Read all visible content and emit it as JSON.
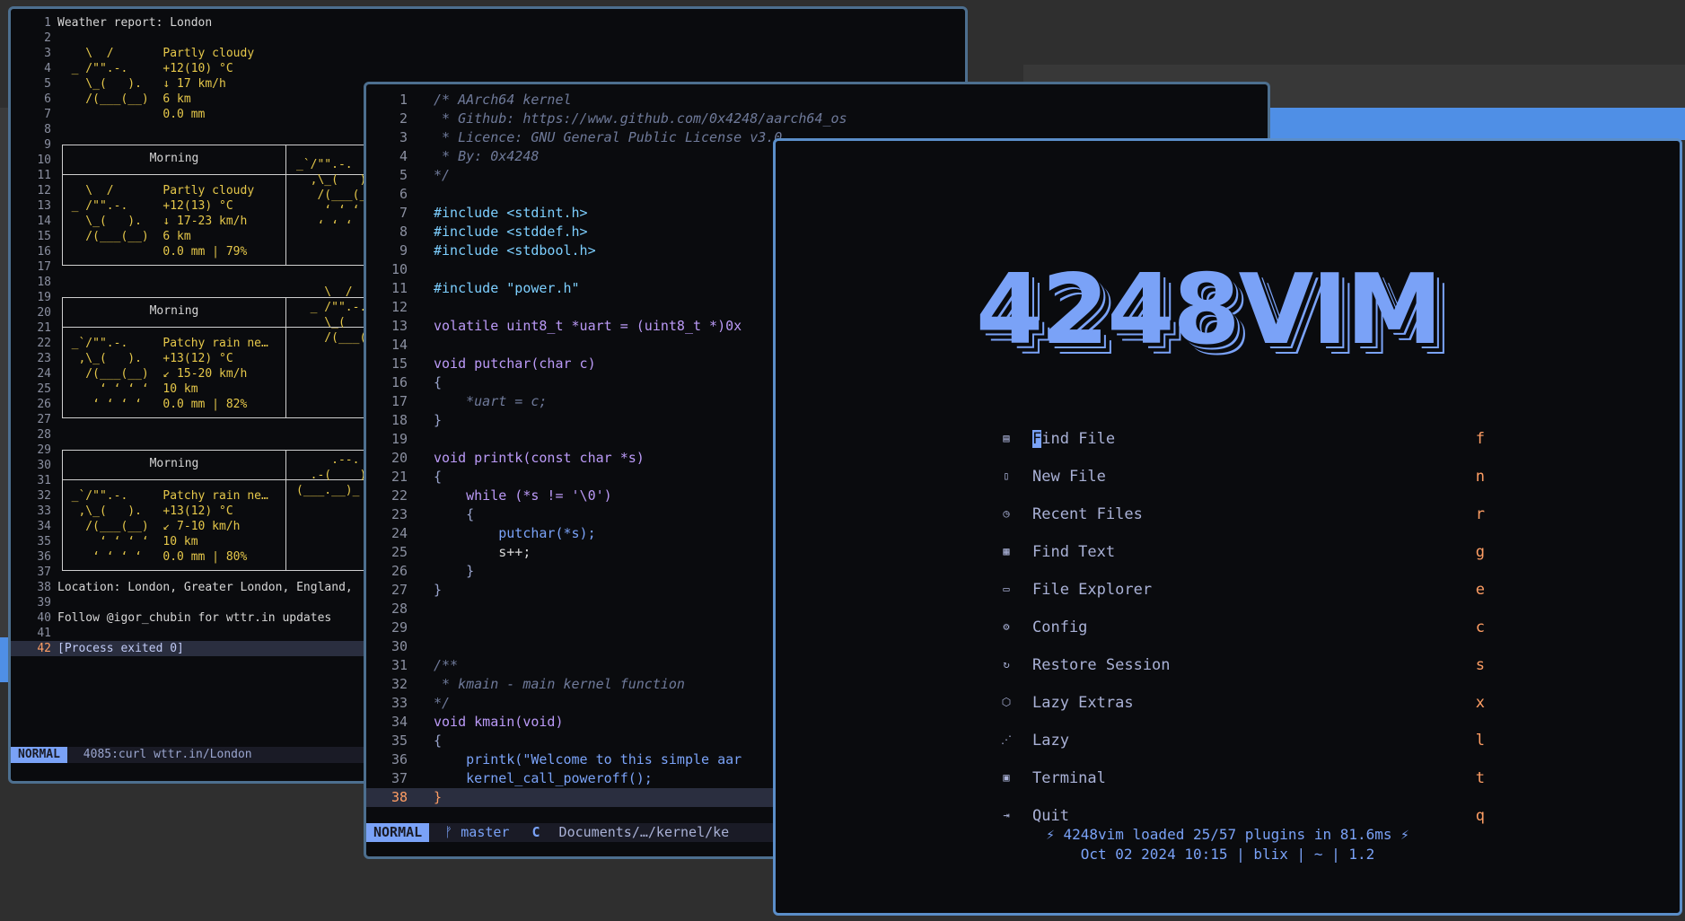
{
  "colors": {
    "accent": "#7aa2f7",
    "background": "#0a0b0e",
    "orange": "#ff9e64"
  },
  "weather": {
    "lines": [
      {
        "n": "1",
        "t": "Weather report: London"
      },
      {
        "n": "2",
        "t": ""
      },
      {
        "n": "3",
        "t": "    \\  /       Partly cloudy"
      },
      {
        "n": "4",
        "t": "  _ /\"\".-.     +12(10) °C"
      },
      {
        "n": "5",
        "t": "    \\_(   ).   ↓ 17 km/h"
      },
      {
        "n": "6",
        "t": "    /(___(__)  6 km"
      },
      {
        "n": "7",
        "t": "               0.0 mm"
      },
      {
        "n": "8",
        "t": ""
      },
      {
        "n": "9",
        "t": ""
      },
      {
        "n": "10",
        "t": ""
      },
      {
        "n": "11",
        "t": ""
      },
      {
        "n": "12",
        "t": "    \\  /       Partly cloudy"
      },
      {
        "n": "13",
        "t": "  _ /\"\".-.     +12(13) °C"
      },
      {
        "n": "14",
        "t": "    \\_(   ).   ↓ 17-23 km/h"
      },
      {
        "n": "15",
        "t": "    /(___(__)  6 km"
      },
      {
        "n": "16",
        "t": "               0.0 mm | 79%"
      },
      {
        "n": "17",
        "t": ""
      },
      {
        "n": "18",
        "t": ""
      },
      {
        "n": "19",
        "t": ""
      },
      {
        "n": "20",
        "t": ""
      },
      {
        "n": "21",
        "t": ""
      },
      {
        "n": "22",
        "t": "  _`/\"\".-.     Patchy rain ne…"
      },
      {
        "n": "23",
        "t": "   ,\\_(   ).   +13(12) °C"
      },
      {
        "n": "24",
        "t": "    /(___(__)  ↙ 15-20 km/h"
      },
      {
        "n": "25",
        "t": "      ‘ ‘ ‘ ‘  10 km"
      },
      {
        "n": "26",
        "t": "     ‘ ‘ ‘ ‘   0.0 mm | 82%"
      },
      {
        "n": "27",
        "t": ""
      },
      {
        "n": "28",
        "t": ""
      },
      {
        "n": "29",
        "t": ""
      },
      {
        "n": "30",
        "t": ""
      },
      {
        "n": "31",
        "t": ""
      },
      {
        "n": "32",
        "t": "  _`/\"\".-.     Patchy rain ne…"
      },
      {
        "n": "33",
        "t": "   ,\\_(   ).   +13(12) °C"
      },
      {
        "n": "34",
        "t": "    /(___(__)  ↙ 7-10 km/h"
      },
      {
        "n": "35",
        "t": "      ‘ ‘ ‘ ‘  10 km"
      },
      {
        "n": "36",
        "t": "     ‘ ‘ ‘ ‘   0.0 mm | 80%"
      },
      {
        "n": "37",
        "t": ""
      },
      {
        "n": "38",
        "t": "Location: London, Greater London, England,"
      },
      {
        "n": "39",
        "t": ""
      },
      {
        "n": "40",
        "t": "Follow @igor_chubin for wttr.in updates"
      },
      {
        "n": "41",
        "t": ""
      },
      {
        "n": "42",
        "t": "[Process exited 0]"
      }
    ],
    "box_titles": [
      "Morning",
      "Morning",
      "Morning"
    ],
    "box2_right": [
      "_`/\"\".-.",
      "  ,\\_(   )",
      "   /(___(_",
      "    ‘ ‘ ‘",
      "   ‘ ‘ ‘"
    ],
    "box3_right": [
      "    \\  /",
      "  _ /\"\".-.",
      "    \\_(   )",
      "    /(___("
    ],
    "box4_right": [
      "",
      "     .--.",
      "  .-(    )",
      "(___.__)_"
    ],
    "status_mode": "NORMAL",
    "status_text": "4085:curl wttr.in/London"
  },
  "code": {
    "lines": [
      {
        "n": "1",
        "t": "/* AArch64 kernel"
      },
      {
        "n": "2",
        "t": " * Github: https://www.github.com/0x4248/aarch64_os"
      },
      {
        "n": "3",
        "t": " * Licence: GNU General Public License v3.0"
      },
      {
        "n": "4",
        "t": " * By: 0x4248"
      },
      {
        "n": "5",
        "t": "*/"
      },
      {
        "n": "6",
        "t": ""
      },
      {
        "n": "7",
        "t": "#include <stdint.h>"
      },
      {
        "n": "8",
        "t": "#include <stddef.h>"
      },
      {
        "n": "9",
        "t": "#include <stdbool.h>"
      },
      {
        "n": "10",
        "t": ""
      },
      {
        "n": "11",
        "t": "#include \"power.h\""
      },
      {
        "n": "12",
        "t": ""
      },
      {
        "n": "13",
        "t": "volatile uint8_t *uart = (uint8_t *)0x"
      },
      {
        "n": "14",
        "t": ""
      },
      {
        "n": "15",
        "t": "void putchar(char c)"
      },
      {
        "n": "16",
        "t": "{"
      },
      {
        "n": "17",
        "t": "    *uart = c;"
      },
      {
        "n": "18",
        "t": "}"
      },
      {
        "n": "19",
        "t": ""
      },
      {
        "n": "20",
        "t": "void printk(const char *s)"
      },
      {
        "n": "21",
        "t": "{"
      },
      {
        "n": "22",
        "t": "    while (*s != '\\0')"
      },
      {
        "n": "23",
        "t": "    {"
      },
      {
        "n": "24",
        "t": "        putchar(*s);"
      },
      {
        "n": "25",
        "t": "        s++;"
      },
      {
        "n": "26",
        "t": "    }"
      },
      {
        "n": "27",
        "t": "}"
      },
      {
        "n": "28",
        "t": ""
      },
      {
        "n": "29",
        "t": ""
      },
      {
        "n": "30",
        "t": ""
      },
      {
        "n": "31",
        "t": "/**"
      },
      {
        "n": "32",
        "t": " * kmain - main kernel function"
      },
      {
        "n": "33",
        "t": "*/"
      },
      {
        "n": "34",
        "t": "void kmain(void)"
      },
      {
        "n": "35",
        "t": "{"
      },
      {
        "n": "36",
        "t": "    printk(\"Welcome to this simple aar"
      },
      {
        "n": "37",
        "t": "    kernel_call_poweroff();"
      },
      {
        "n": "38",
        "t": "}"
      }
    ],
    "status_mode": "NORMAL",
    "branch": "master",
    "lang": "C",
    "path": "Documents/…/kernel/ke"
  },
  "dashboard": {
    "logo": "4248VIM",
    "items": [
      {
        "icon": "file-search-icon",
        "glyph": "▤",
        "label": "Find File",
        "key": "f"
      },
      {
        "icon": "new-file-icon",
        "glyph": "▯",
        "label": "New File",
        "key": "n"
      },
      {
        "icon": "recent-files-icon",
        "glyph": "◷",
        "label": "Recent Files",
        "key": "r"
      },
      {
        "icon": "find-text-icon",
        "glyph": "▦",
        "label": "Find Text",
        "key": "g"
      },
      {
        "icon": "folder-icon",
        "glyph": "▭",
        "label": "File Explorer",
        "key": "e"
      },
      {
        "icon": "gear-icon",
        "glyph": "⚙",
        "label": "Config",
        "key": "c"
      },
      {
        "icon": "restore-icon",
        "glyph": "↻",
        "label": "Restore Session",
        "key": "s"
      },
      {
        "icon": "box-icon",
        "glyph": "⬡",
        "label": "Lazy Extras",
        "key": "x"
      },
      {
        "icon": "lazy-icon",
        "glyph": "⋰",
        "label": "Lazy",
        "key": "l"
      },
      {
        "icon": "terminal-icon",
        "glyph": "▣",
        "label": "Terminal",
        "key": "t"
      },
      {
        "icon": "quit-icon",
        "glyph": "⇥",
        "label": "Quit",
        "key": "q"
      }
    ],
    "footer1": "⚡ 4248vim loaded 25/57 plugins in 81.6ms ⚡",
    "footer2": "Oct 02 2024 10:15 | blix | ~ | 1.2"
  }
}
